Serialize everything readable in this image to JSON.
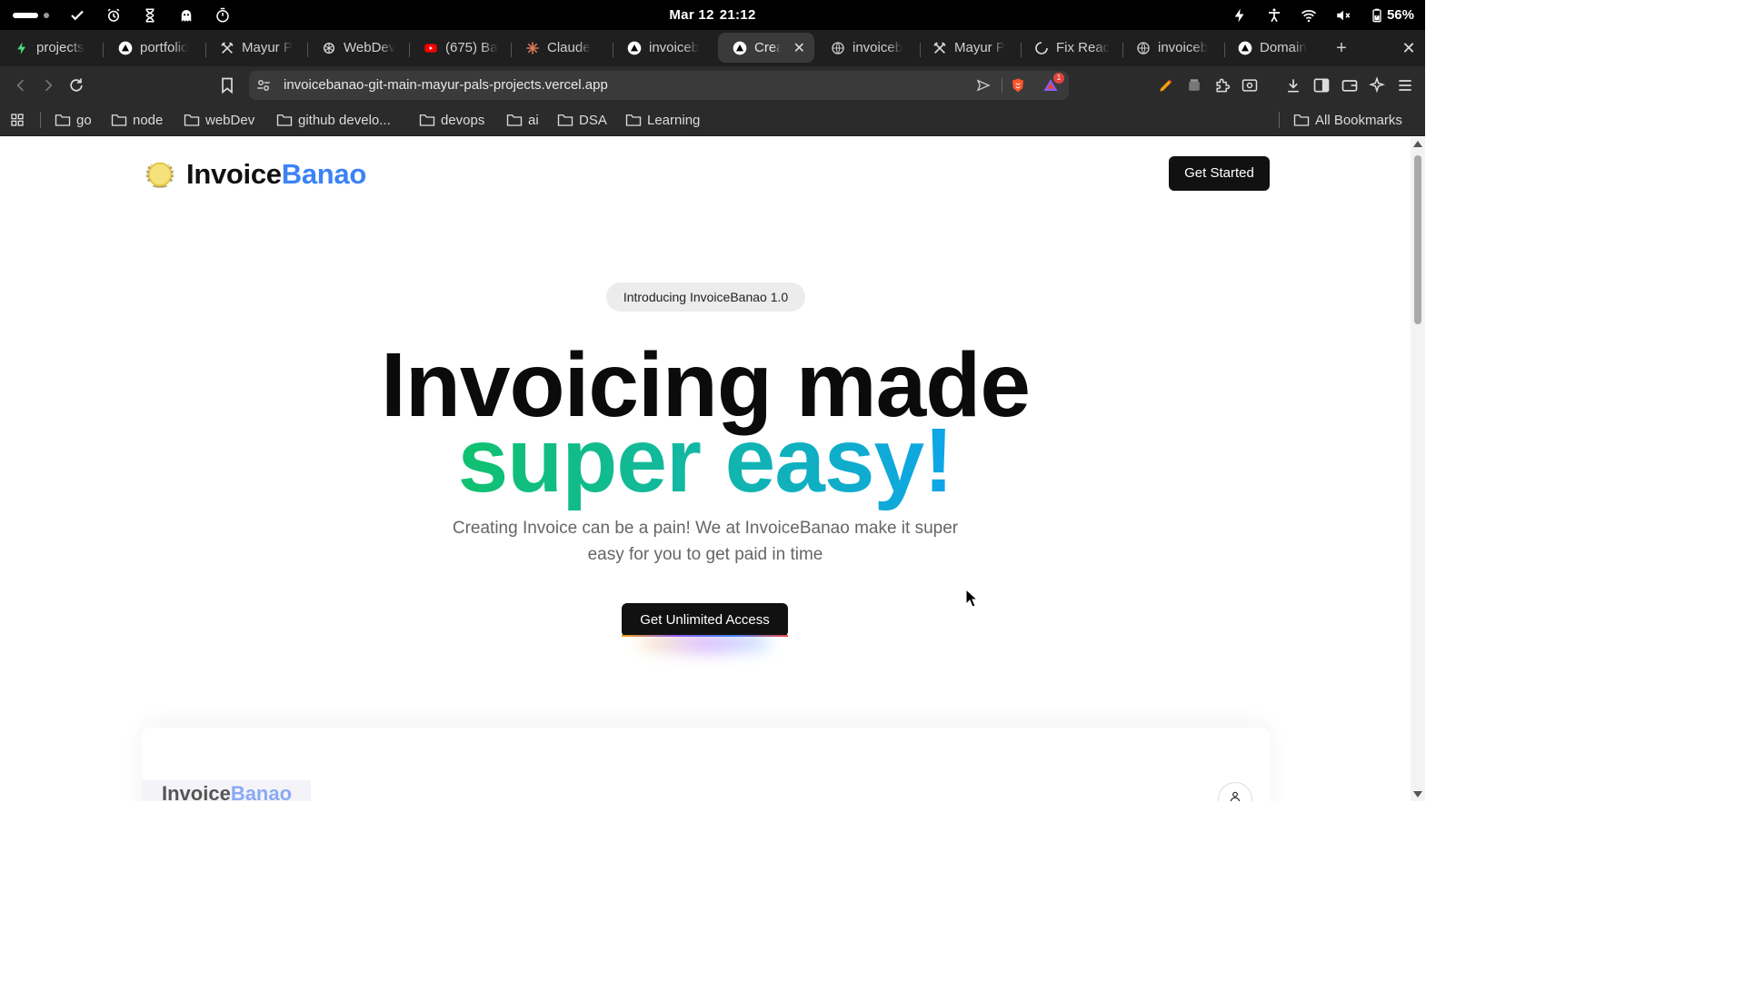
{
  "os": {
    "date": "Mar 12",
    "time": "21:12",
    "battery": "56%",
    "left_icons": [
      "check-icon",
      "alarm-icon",
      "hourglass-icon",
      "ghost-icon",
      "timer-icon"
    ],
    "right_icons": [
      "bolt-icon",
      "accessibility-icon",
      "wifi-icon",
      "muted-speaker-icon",
      "battery-icon"
    ]
  },
  "tabs": [
    {
      "label": "projects",
      "icon": "vercel-bolt-icon",
      "color": "#4ade80"
    },
    {
      "label": "portfolio",
      "icon": "vercel-triangle-icon"
    },
    {
      "label": "Mayur P",
      "icon": "crossed-swords-icon"
    },
    {
      "label": "WebDev",
      "icon": "openai-icon"
    },
    {
      "label": "(675) Ba",
      "icon": "youtube-icon",
      "color": "#ff0000"
    },
    {
      "label": "Claude",
      "icon": "claude-icon",
      "color": "#d97757"
    },
    {
      "label": "invoiceb",
      "icon": "vercel-triangle-icon"
    },
    {
      "label": "Creat",
      "icon": "vercel-triangle-icon",
      "active": true
    },
    {
      "label": "invoiceb",
      "icon": "globe-icon"
    },
    {
      "label": "Mayur P",
      "icon": "crossed-swords-icon"
    },
    {
      "label": "Fix Reac",
      "icon": "github-icon"
    },
    {
      "label": "invoiceb",
      "icon": "globe-icon"
    },
    {
      "label": "Domain",
      "icon": "vercel-triangle-icon"
    }
  ],
  "toolbar": {
    "url": "invoicebanao-git-main-mayur-pals-projects.vercel.app",
    "shield_badge": "1"
  },
  "bookmarks": {
    "items": [
      "go",
      "node",
      "webDev",
      "github develo...",
      "devops",
      "ai",
      "DSA",
      "Learning"
    ],
    "all_label": "All Bookmarks"
  },
  "page": {
    "logo_primary": "Invoice",
    "logo_accent": "Banao",
    "get_started": "Get Started",
    "intro_pill": "Introducing InvoiceBanao 1.0",
    "headline_line1": "Invoicing made",
    "headline_line2": "super easy!",
    "subtext": "Creating Invoice can be a pain! We at InvoiceBanao make it super easy for you to get paid in time",
    "cta": "Get Unlimited Access",
    "preview_logo_primary": "Invoice",
    "preview_logo_accent": "Banao",
    "accent_color": "#3b82f6"
  }
}
